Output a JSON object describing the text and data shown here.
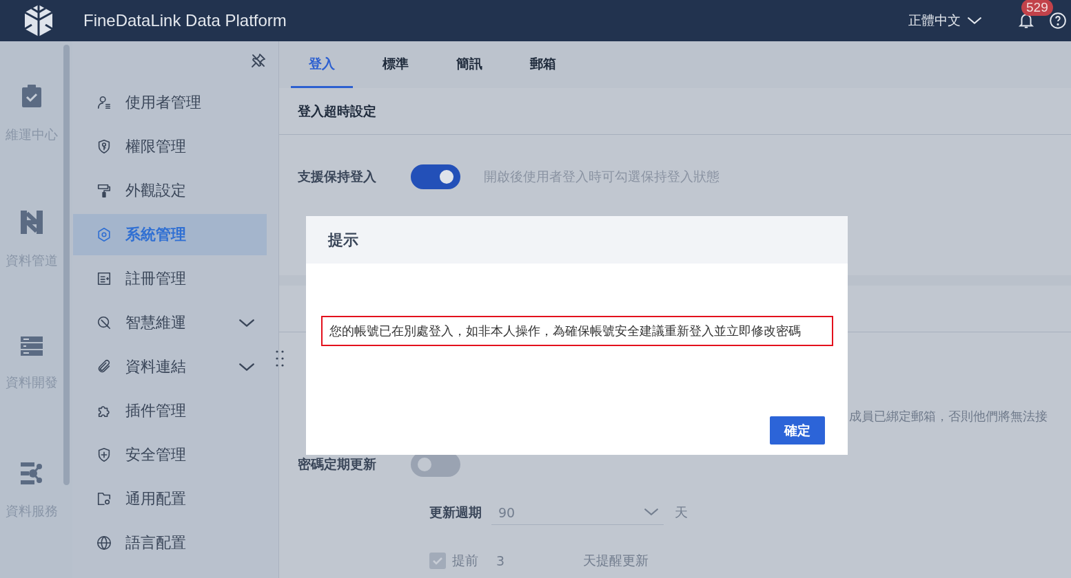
{
  "header": {
    "title": "FineDataLink Data Platform",
    "language": "正體中文",
    "notification_count": "529"
  },
  "rail": [
    {
      "label": "維運中心"
    },
    {
      "label": "資料管道"
    },
    {
      "label": "資料開發"
    },
    {
      "label": "資料服務"
    }
  ],
  "sidebar": {
    "items": [
      {
        "label": "使用者管理",
        "selected": false
      },
      {
        "label": "權限管理",
        "selected": false
      },
      {
        "label": "外觀設定",
        "selected": false
      },
      {
        "label": "系統管理",
        "selected": true
      },
      {
        "label": "註冊管理",
        "selected": false
      },
      {
        "label": "智慧維運",
        "selected": false,
        "expanded": false
      },
      {
        "label": "資料連結",
        "selected": false,
        "expanded": false
      },
      {
        "label": "插件管理",
        "selected": false
      },
      {
        "label": "安全管理",
        "selected": false
      },
      {
        "label": "通用配置",
        "selected": false
      },
      {
        "label": "語言配置",
        "selected": false
      }
    ]
  },
  "tabs": [
    {
      "label": "登入",
      "selected": true
    },
    {
      "label": "標準",
      "selected": false
    },
    {
      "label": "簡訊",
      "selected": false
    },
    {
      "label": "郵箱",
      "selected": false
    }
  ],
  "sections": [
    {
      "title": "登入超時設定",
      "rows": [
        {
          "kind": "toggle",
          "label": "支援保持登入",
          "on": true,
          "description": "開啟後使用者登入時可勾選保持登入狀態"
        }
      ]
    },
    {
      "rows": [
        {
          "kind": "note",
          "text": "成員已綁定郵箱，否則他們將無法接"
        },
        {
          "kind": "toggle",
          "label": "密碼定期更新",
          "on": false
        },
        {
          "kind": "select",
          "label": "更新週期",
          "value": "90",
          "unit": "天"
        },
        {
          "kind": "checkbox",
          "label": "提前",
          "checked": true,
          "value": "3",
          "suffix": "天提醒更新"
        }
      ]
    }
  ],
  "dialog": {
    "title": "提示",
    "message": "您的帳號已在別處登入，如非本人操作，為確保帳號安全建議重新登入並立即修改密碼",
    "button": "確定"
  }
}
